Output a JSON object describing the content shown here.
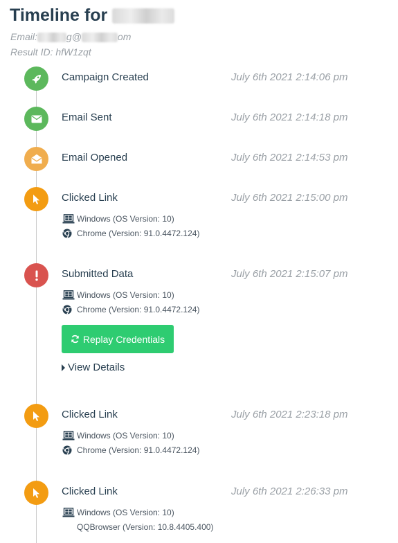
{
  "header": {
    "title": "Timeline for",
    "email_label": "Email:",
    "email_visible_parts": [
      "g@",
      "om"
    ],
    "result_id_label": "Result ID:",
    "result_id": "hfW1zqt"
  },
  "events": [
    {
      "label": "Campaign Created",
      "time": "July 6th 2021 2:14:06 pm",
      "icon": "rocket-icon",
      "color": "#5cb85c"
    },
    {
      "label": "Email Sent",
      "time": "July 6th 2021 2:14:18 pm",
      "icon": "envelope-icon",
      "color": "#5cb85c"
    },
    {
      "label": "Email Opened",
      "time": "July 6th 2021 2:14:53 pm",
      "icon": "envelope-open-icon",
      "color": "#f0ad4e"
    },
    {
      "label": "Clicked Link",
      "time": "July 6th 2021 2:15:00 pm",
      "icon": "mouse-pointer-icon",
      "color": "#f39c12",
      "os": "Windows (OS Version: 10)",
      "browser": "Chrome (Version: 91.0.4472.124)"
    },
    {
      "label": "Submitted Data",
      "time": "July 6th 2021 2:15:07 pm",
      "icon": "exclamation-icon",
      "color": "#d9534f",
      "os": "Windows (OS Version: 10)",
      "browser": "Chrome (Version: 91.0.4472.124)",
      "replay_label": "Replay Credentials",
      "view_details_label": "View Details"
    },
    {
      "label": "Clicked Link",
      "time": "July 6th 2021 2:23:18 pm",
      "icon": "mouse-pointer-icon",
      "color": "#f39c12",
      "os": "Windows (OS Version: 10)",
      "browser": "Chrome (Version: 91.0.4472.124)"
    },
    {
      "label": "Clicked Link",
      "time": "July 6th 2021 2:26:33 pm",
      "icon": "mouse-pointer-icon",
      "color": "#f39c12",
      "os": "Windows (OS Version: 10)",
      "browser": "QQBrowser (Version: 10.8.4405.400)"
    }
  ]
}
